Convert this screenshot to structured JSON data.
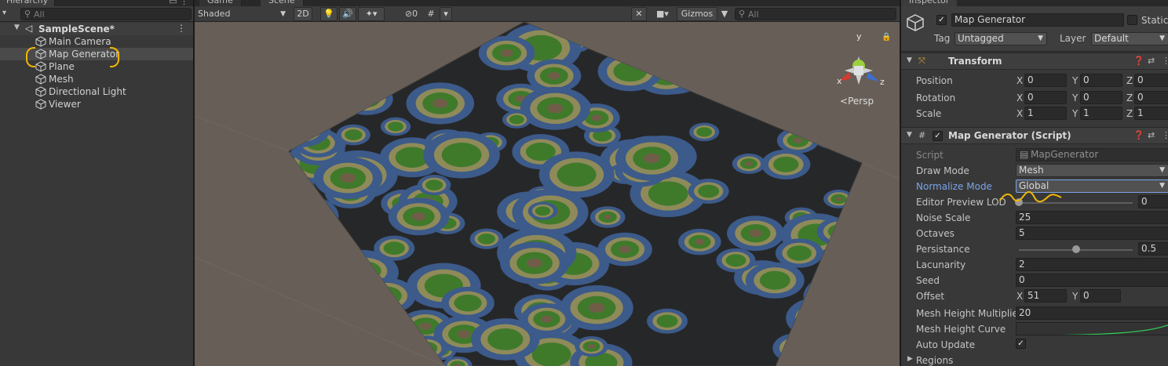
{
  "hierarchy": {
    "tab_label": "Hierarchy",
    "search_placeholder": "All",
    "scene_name": "SampleScene*",
    "items": [
      {
        "label": "Main Camera"
      },
      {
        "label": "Map Generator",
        "selected": true
      },
      {
        "label": "Plane"
      },
      {
        "label": "Mesh"
      },
      {
        "label": "Directional Light"
      },
      {
        "label": "Viewer"
      }
    ]
  },
  "scene_view": {
    "tabs": [
      {
        "label": "Game"
      },
      {
        "label": "Scene"
      }
    ],
    "shading_mode": "Shaded",
    "mode_2d": "2D",
    "gizmos_label": "Gizmos",
    "search_placeholder": "All",
    "hidden_count": "0",
    "persp_label": "Persp",
    "axis_labels": {
      "x": "x",
      "y": "y",
      "z": "z"
    },
    "colors": {
      "background": "#675e57",
      "water_deep": "#262729",
      "water": "#3c5a8a",
      "sand": "#8f8a5a",
      "grass": "#3f7a2b",
      "rock": "#6f5d48"
    }
  },
  "inspector": {
    "tab_label": "Inspector",
    "object_name": "Map Generator",
    "static_label": "Static",
    "tag_label": "Tag",
    "tag_value": "Untagged",
    "layer_label": "Layer",
    "layer_value": "Default",
    "transform": {
      "title": "Transform",
      "position": {
        "label": "Position",
        "x": "0",
        "y": "0",
        "z": "0"
      },
      "rotation": {
        "label": "Rotation",
        "x": "0",
        "y": "0",
        "z": "0"
      },
      "scale": {
        "label": "Scale",
        "x": "1",
        "y": "1",
        "z": "1"
      }
    },
    "map_generator": {
      "title": "Map Generator (Script)",
      "script_label": "Script",
      "script_value": "MapGenerator",
      "draw_mode_label": "Draw Mode",
      "draw_mode_value": "Mesh",
      "normalize_mode_label": "Normalize Mode",
      "normalize_mode_value": "Global",
      "lod_label": "Editor Preview LOD",
      "lod_value": "0",
      "lod_fraction": 0,
      "noise_scale_label": "Noise Scale",
      "noise_scale_value": "25",
      "octaves_label": "Octaves",
      "octaves_value": "5",
      "persistance_label": "Persistance",
      "persistance_value": "0.5",
      "persistance_fraction": 0.5,
      "lacunarity_label": "Lacunarity",
      "lacunarity_value": "2",
      "seed_label": "Seed",
      "seed_value": "0",
      "offset_label": "Offset",
      "offset_x": "51",
      "offset_y": "0",
      "mesh_height_multiplier_label": "Mesh Height Multiplier",
      "mesh_height_multiplier_value": "20",
      "mesh_height_curve_label": "Mesh Height Curve",
      "auto_update_label": "Auto Update",
      "auto_update_checked": true,
      "regions_label": "Regions"
    }
  },
  "axis_letters": {
    "x": "X",
    "y": "Y",
    "z": "Z"
  },
  "annotation_color": "#f2b705"
}
